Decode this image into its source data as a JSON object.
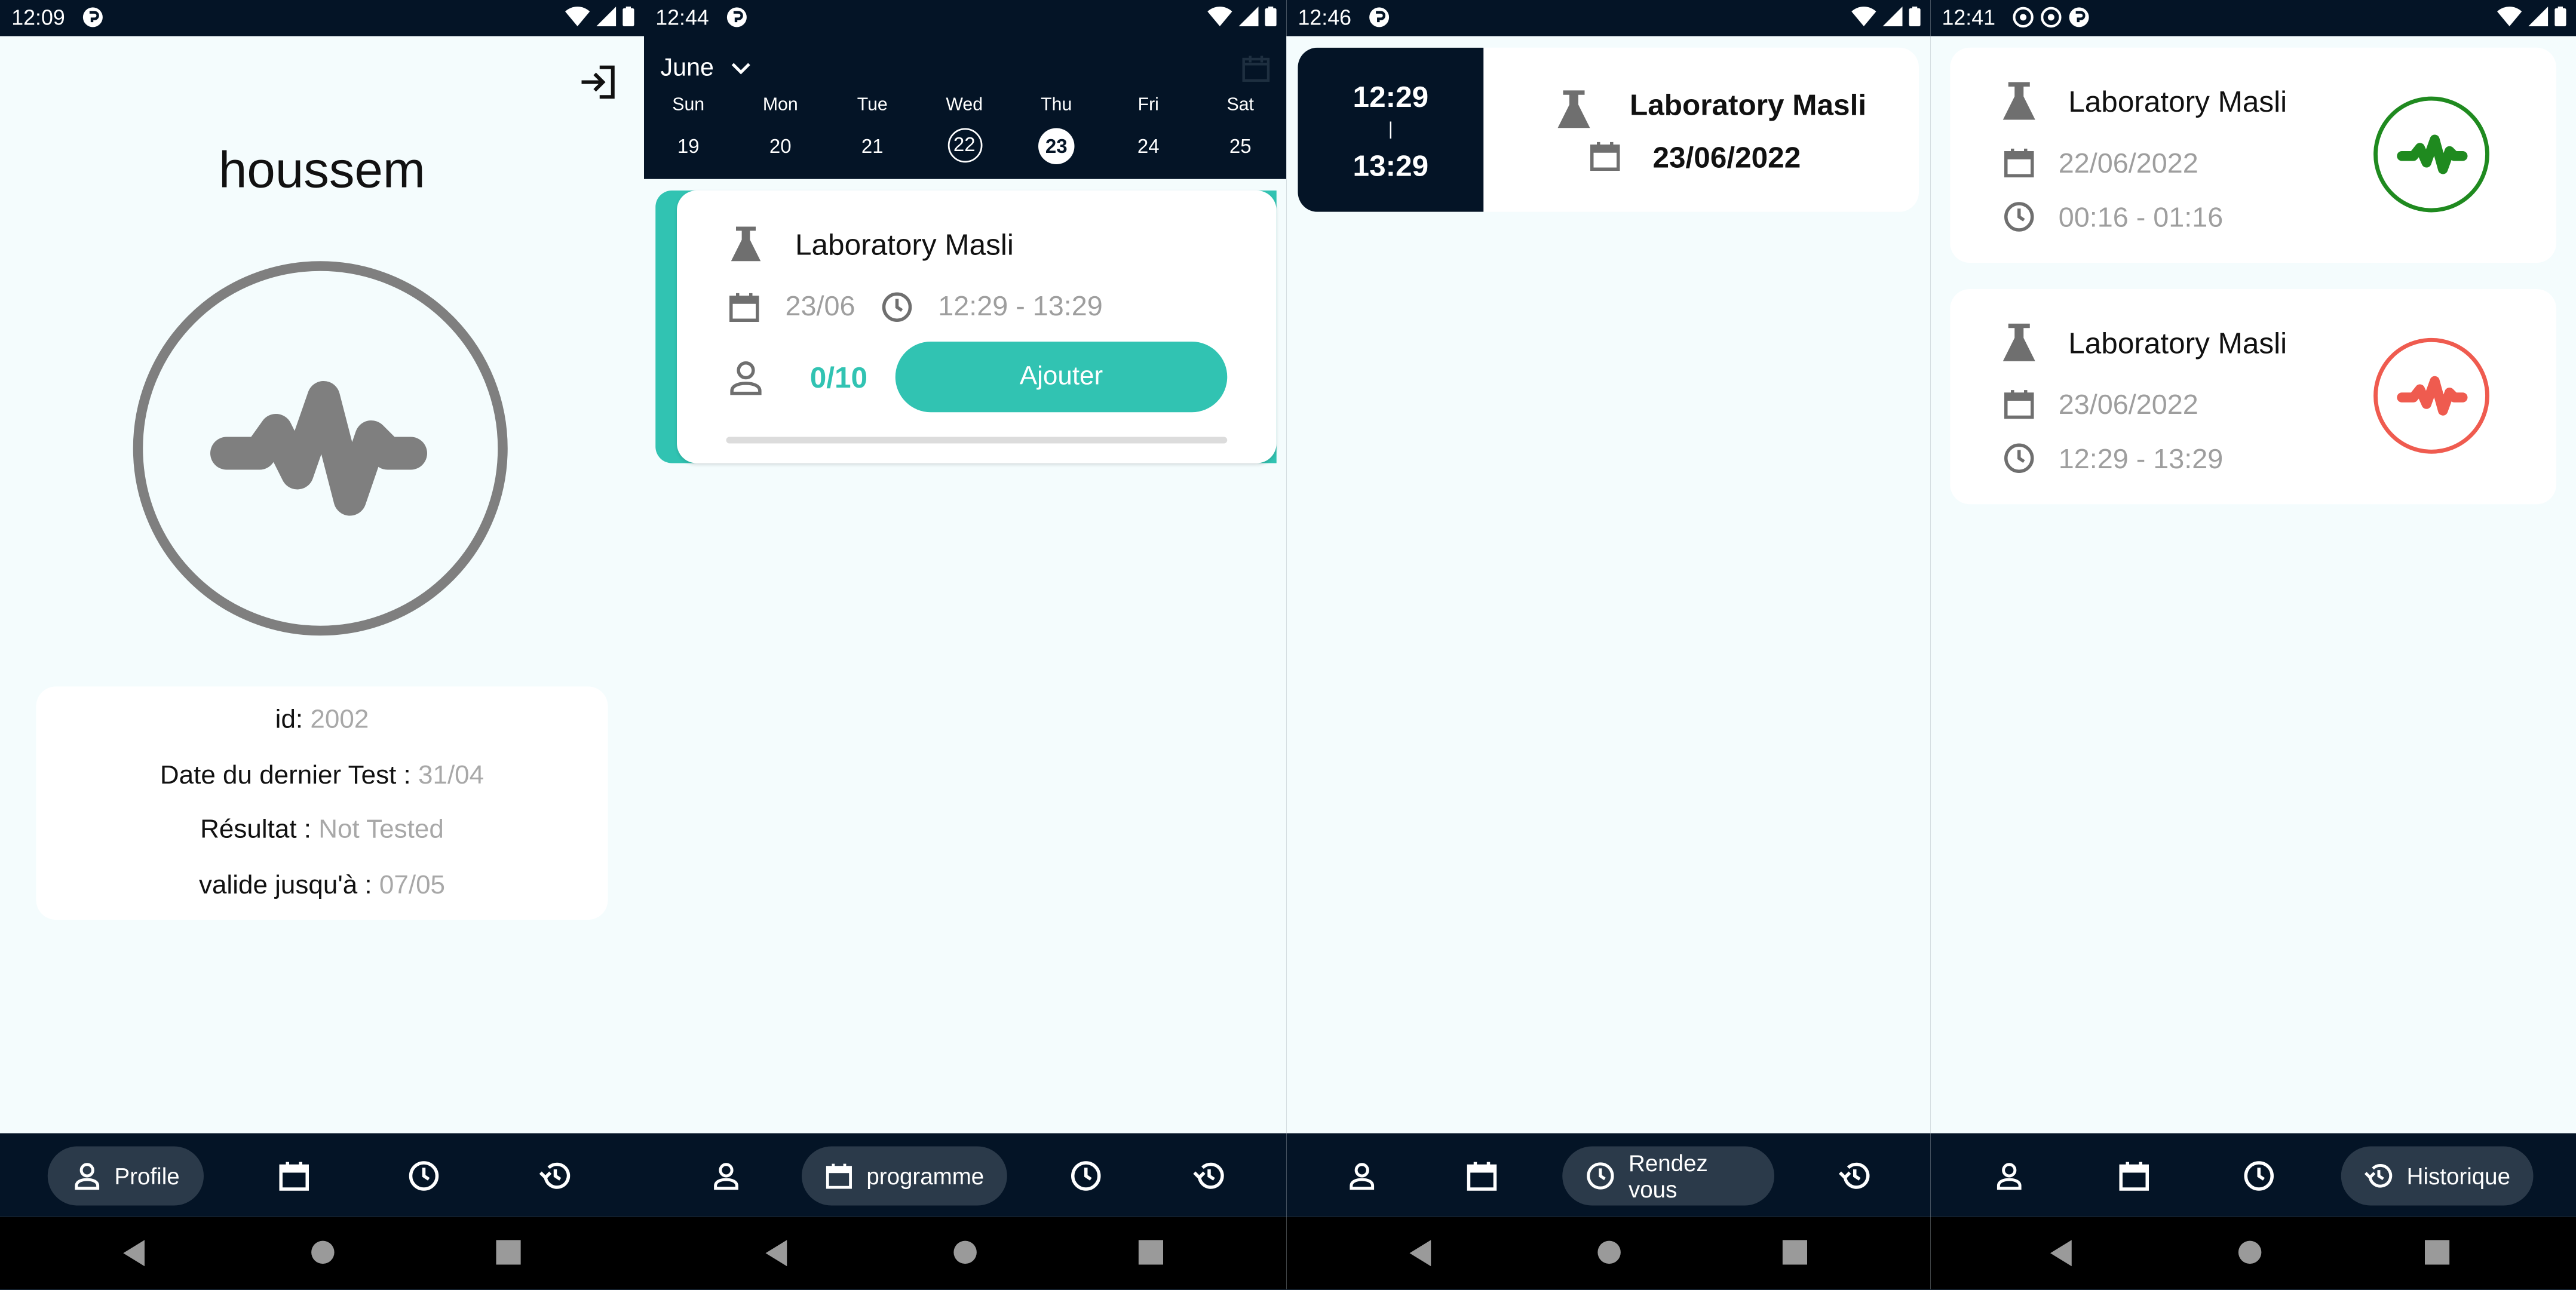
{
  "colors": {
    "dark": "#041426",
    "teal": "#31c3b2",
    "green": "#1f8a1f",
    "red": "#ef5b4f",
    "icon_grey": "#6f6f6f",
    "muted": "#9e9e9e"
  },
  "screens": [
    {
      "status_time": "12:09",
      "profile": {
        "name": "houssem",
        "rows": [
          {
            "label": "id:",
            "value": "2002"
          },
          {
            "label": "Date du dernier Test :",
            "value": "31/04"
          },
          {
            "label": "Résultat :",
            "value": "Not Tested"
          },
          {
            "label": "valide jusqu'à :",
            "value": "07/05"
          }
        ]
      },
      "nav_active_label": "Profile"
    },
    {
      "status_time": "12:44",
      "calendar": {
        "month": "June",
        "days": [
          {
            "dow": "Sun",
            "num": "19"
          },
          {
            "dow": "Mon",
            "num": "20"
          },
          {
            "dow": "Tue",
            "num": "21"
          },
          {
            "dow": "Wed",
            "num": "22"
          },
          {
            "dow": "Thu",
            "num": "23"
          },
          {
            "dow": "Fri",
            "num": "24"
          },
          {
            "dow": "Sat",
            "num": "25"
          }
        ]
      },
      "slot": {
        "lab": "Laboratory Masli",
        "date": "23/06",
        "time": "12:29 - 13:29",
        "count": "0/10",
        "button": "Ajouter"
      },
      "nav_active_label": "programme"
    },
    {
      "status_time": "12:46",
      "appointment": {
        "start": "12:29",
        "sep": "|",
        "end": "13:29",
        "lab": "Laboratory Masli",
        "date": "23/06/2022"
      },
      "nav_active_label": "Rendez vous"
    },
    {
      "status_time": "12:41",
      "history": [
        {
          "lab": "Laboratory Masli",
          "date": "22/06/2022",
          "time": "00:16 - 01:16",
          "result_icon": "pulse-green"
        },
        {
          "lab": "Laboratory Masli",
          "date": "23/06/2022",
          "time": "12:29 - 13:29",
          "result_icon": "pulse-red"
        }
      ],
      "nav_active_label": "Historique"
    }
  ]
}
